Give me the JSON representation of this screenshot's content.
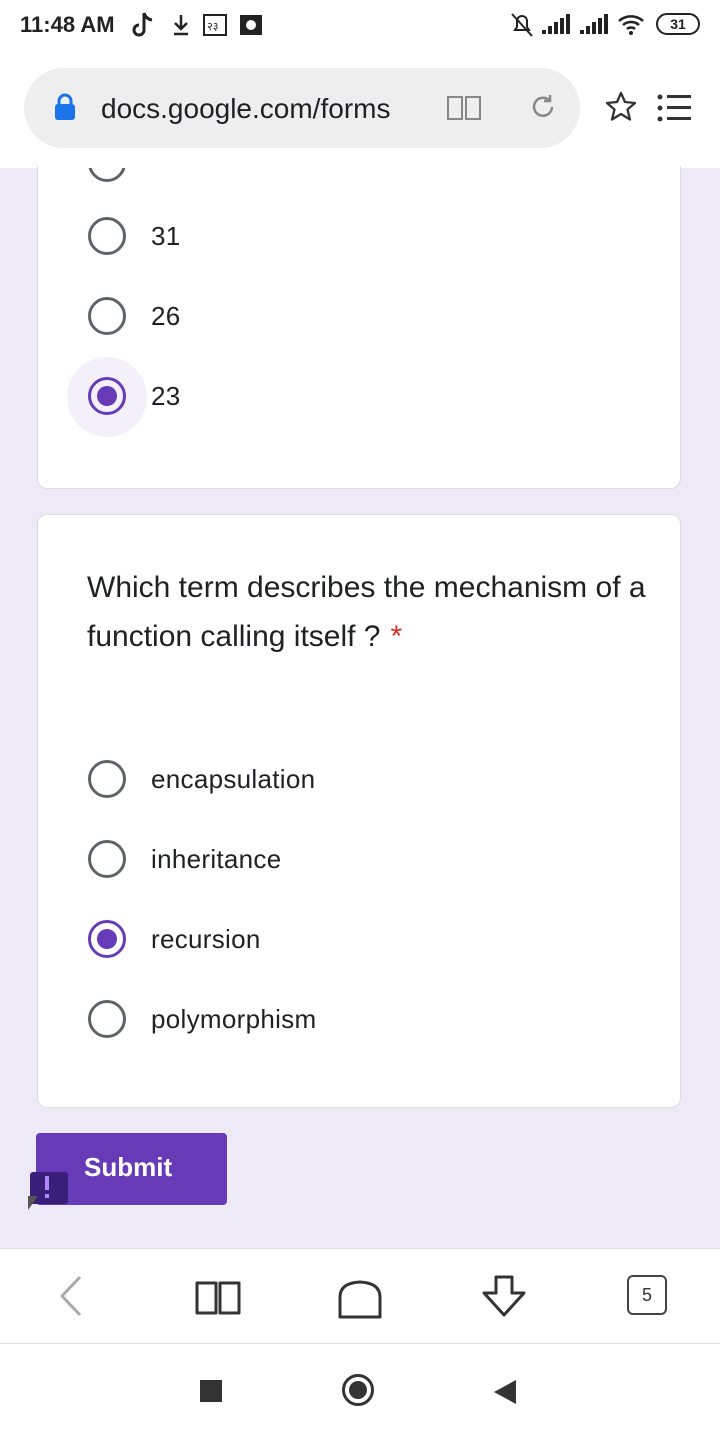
{
  "status_bar": {
    "time": "11:48 AM",
    "battery": "31",
    "icons": [
      "tiktok-icon",
      "download-icon",
      "app-icon",
      "gallery-icon",
      "mute-icon",
      "signal-icon",
      "signal-icon",
      "wifi-icon",
      "battery-icon"
    ]
  },
  "browser": {
    "url": "docs.google.com/forms",
    "tab_count": "5"
  },
  "question1": {
    "options": [
      {
        "label": "31",
        "selected": false
      },
      {
        "label": "26",
        "selected": false
      },
      {
        "label": "23",
        "selected": true
      }
    ]
  },
  "question2": {
    "text": "Which term describes the mechanism of a function calling itself ?",
    "required_mark": "*",
    "options": [
      {
        "label": "encapsulation",
        "selected": false
      },
      {
        "label": "inheritance",
        "selected": false
      },
      {
        "label": "recursion",
        "selected": true
      },
      {
        "label": "polymorphism",
        "selected": false
      }
    ]
  },
  "form": {
    "submit_label": "Submit"
  },
  "colors": {
    "accent": "#673ab7",
    "form_background": "#eee9f7",
    "required": "#d93025"
  }
}
